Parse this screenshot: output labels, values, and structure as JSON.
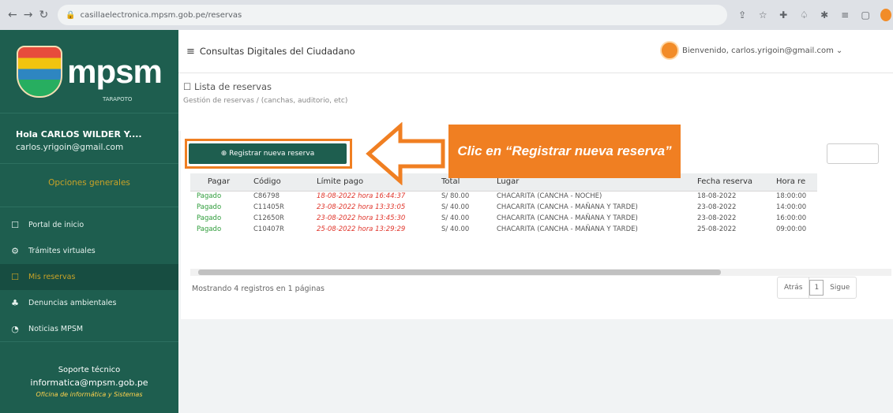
{
  "browser": {
    "url": "casillaelectronica.mpsm.gob.pe/reservas"
  },
  "sidebar": {
    "logo_text": "mpsm",
    "logo_sub": "TARAPOTO",
    "greeting": "Hola CARLOS WILDER Y....",
    "email": "carlos.yrigoin@gmail.com",
    "section_label": "Opciones generales",
    "items": [
      {
        "label": "Portal de inicio",
        "icon": "square-icon"
      },
      {
        "label": "Trámites virtuales",
        "icon": "gear-icon"
      },
      {
        "label": "Mis reservas",
        "icon": "square-icon",
        "active": true
      },
      {
        "label": "Denuncias ambientales",
        "icon": "tree-icon"
      },
      {
        "label": "Noticias MPSM",
        "icon": "bell-icon"
      }
    ],
    "support_title": "Soporte técnico",
    "support_email": "informatica@mpsm.gob.pe",
    "support_office": "Oficina de informática y Sistemas"
  },
  "topbar": {
    "title": "Consultas Digitales del Ciudadano",
    "welcome": "Bienvenido, carlos.yrigoin@gmail.com"
  },
  "page": {
    "title": "Lista de reservas",
    "breadcrumb_main": "Gestión de reservas",
    "breadcrumb_sub": "(canchas, auditorio, etc)"
  },
  "actions": {
    "new_reservation": "Registrar nueva reserva"
  },
  "table": {
    "headers": [
      "Pagar",
      "Código",
      "Límite pago",
      "Total",
      "Lugar",
      "Fecha reserva",
      "Hora re"
    ],
    "rows": [
      [
        "Pagado",
        "C86798",
        "18-08-2022 hora 16:44:37",
        "S/ 80.00",
        "CHACARITA (CANCHA - NOCHE)",
        "18-08-2022",
        "18:00:00"
      ],
      [
        "Pagado",
        "C11405R",
        "23-08-2022 hora 13:33:05",
        "S/ 40.00",
        "CHACARITA (CANCHA - MAÑANA Y TARDE)",
        "23-08-2022",
        "14:00:00"
      ],
      [
        "Pagado",
        "C12650R",
        "23-08-2022 hora 13:45:30",
        "S/ 40.00",
        "CHACARITA (CANCHA - MAÑANA Y TARDE)",
        "23-08-2022",
        "16:00:00"
      ],
      [
        "Pagado",
        "C10407R",
        "25-08-2022 hora 13:29:29",
        "S/ 40.00",
        "CHACARITA (CANCHA - MAÑANA Y TARDE)",
        "25-08-2022",
        "09:00:00"
      ]
    ]
  },
  "footer": {
    "showing": "Mostrando 4 registros en 1 páginas",
    "prev": "Atrás",
    "page": "1",
    "next": "Sigue"
  },
  "annotation": {
    "text": "Clic en “Registrar nueva reserva”",
    "color": "#f07f22"
  },
  "colors": {
    "sidebar": "#1e5e4f",
    "accent": "#c9a227",
    "paid": "#2e9c3a",
    "limit": "#e0352b"
  }
}
